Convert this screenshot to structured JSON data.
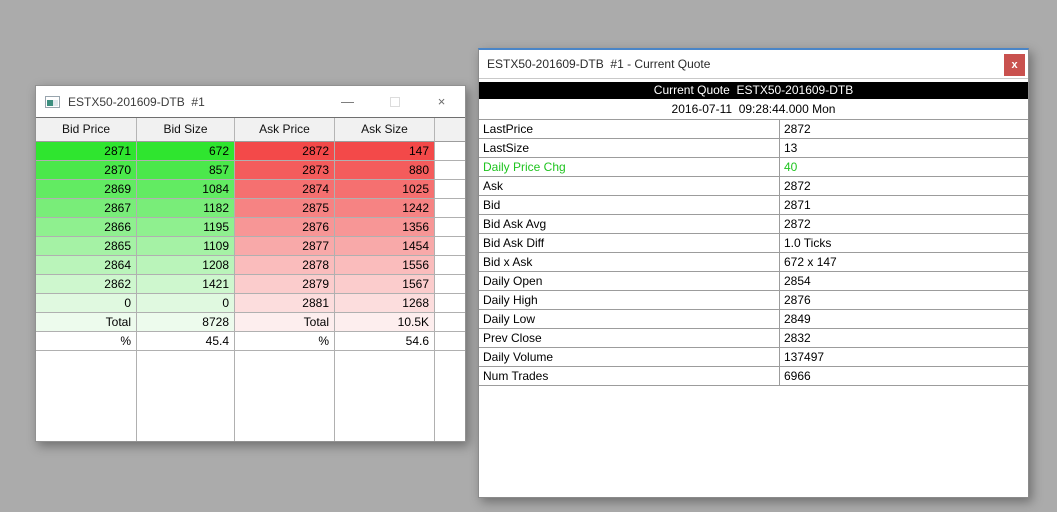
{
  "background_color": "#ababab",
  "depth_window": {
    "title": "ESTX50-201609-DTB  #1",
    "window_controls": {
      "minimize": "—",
      "close": "×"
    },
    "columns": [
      "Bid Price",
      "Bid Size",
      "Ask Price",
      "Ask Size"
    ],
    "rows": [
      {
        "bid_price": "2871",
        "bid_size": "672",
        "ask_price": "2872",
        "ask_size": "147",
        "bid_bg": "#2fe52f",
        "ask_bg": "#f34949"
      },
      {
        "bid_price": "2870",
        "bid_size": "857",
        "ask_price": "2873",
        "ask_size": "880",
        "bid_bg": "#4be84b",
        "ask_bg": "#f45c5c"
      },
      {
        "bid_price": "2869",
        "bid_size": "1084",
        "ask_price": "2874",
        "ask_size": "1025",
        "bid_bg": "#62eb62",
        "ask_bg": "#f57070"
      },
      {
        "bid_price": "2867",
        "bid_size": "1182",
        "ask_price": "2875",
        "ask_size": "1242",
        "bid_bg": "#79ed79",
        "ask_bg": "#f68383"
      },
      {
        "bid_price": "2866",
        "bid_size": "1195",
        "ask_price": "2876",
        "ask_size": "1356",
        "bid_bg": "#8ff08f",
        "ask_bg": "#f79696"
      },
      {
        "bid_price": "2865",
        "bid_size": "1109",
        "ask_price": "2877",
        "ask_size": "1454",
        "bid_bg": "#a5f2a5",
        "ask_bg": "#f8a9a9"
      },
      {
        "bid_price": "2864",
        "bid_size": "1208",
        "ask_price": "2878",
        "ask_size": "1556",
        "bid_bg": "#baf4ba",
        "ask_bg": "#fabcbc"
      },
      {
        "bid_price": "2862",
        "bid_size": "1421",
        "ask_price": "2879",
        "ask_size": "1567",
        "bid_bg": "#cef7ce",
        "ask_bg": "#fbcccc"
      },
      {
        "bid_price": "0",
        "bid_size": "0",
        "ask_price": "2881",
        "ask_size": "1268",
        "bid_bg": "#e0f9e0",
        "ask_bg": "#fcdddd"
      }
    ],
    "total": {
      "bid_label": "Total",
      "bid_value": "8728",
      "ask_label": "Total",
      "ask_value": "10.5K",
      "bid_bg": "#edfbed",
      "ask_bg": "#fdeeee"
    },
    "percent": {
      "bid_label": "%",
      "bid_value": "45.4",
      "ask_label": "%",
      "ask_value": "54.6"
    }
  },
  "quote_window": {
    "title": "ESTX50-201609-DTB  #1 - Current Quote",
    "close_label": "x",
    "banner": "Current Quote  ESTX50-201609-DTB",
    "timestamp": "2016-07-11  09:28:44.000 Mon",
    "accent_green": "#1fc41f",
    "fields": [
      {
        "label": "LastPrice",
        "value": "2872"
      },
      {
        "label": "LastSize",
        "value": "13"
      },
      {
        "label": "Daily Price Chg",
        "value": "40",
        "color": "#1fc41f"
      },
      {
        "label": "Ask",
        "value": "2872"
      },
      {
        "label": "Bid",
        "value": "2871"
      },
      {
        "label": "Bid Ask Avg",
        "value": "2872"
      },
      {
        "label": "Bid Ask Diff",
        "value": "1.0 Ticks"
      },
      {
        "label": "Bid x Ask",
        "value": "672 x 147"
      },
      {
        "label": "Daily Open",
        "value": "2854"
      },
      {
        "label": "Daily High",
        "value": "2876"
      },
      {
        "label": "Daily Low",
        "value": "2849"
      },
      {
        "label": "Prev Close",
        "value": "2832"
      },
      {
        "label": "Daily Volume",
        "value": "137497"
      },
      {
        "label": "Num Trades",
        "value": "6966"
      }
    ]
  }
}
